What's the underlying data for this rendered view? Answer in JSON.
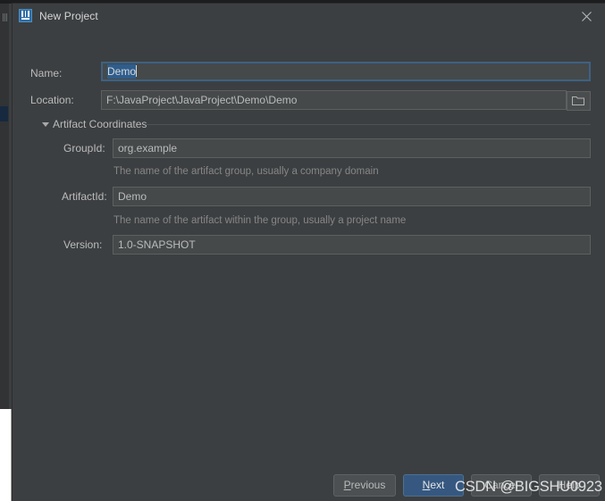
{
  "window": {
    "title": "New Project",
    "app_icon": "intellij-idea-icon",
    "close_icon": "close-icon"
  },
  "form": {
    "name": {
      "label": "Name:",
      "value": "Demo",
      "selected": true
    },
    "location": {
      "label": "Location:",
      "value": "F:\\JavaProject\\JavaProject\\Demo\\Demo",
      "browse_icon": "folder-icon"
    }
  },
  "section": {
    "label": "Artifact Coordinates",
    "expanded": true,
    "toggle_icon": "chevron-down-icon",
    "fields": [
      {
        "label": "GroupId:",
        "value": "org.example",
        "helper": "The name of the artifact group, usually a company domain"
      },
      {
        "label": "ArtifactId:",
        "value": "Demo",
        "helper": "The name of the artifact within the group, usually a project name"
      },
      {
        "label": "Version:",
        "value": "1.0-SNAPSHOT",
        "helper": ""
      }
    ]
  },
  "buttons": {
    "previous": {
      "label": "Previous",
      "mnemonic": "P"
    },
    "next": {
      "label": "Next",
      "mnemonic": "N",
      "default": true
    },
    "cancel": {
      "label": "Cancel"
    },
    "help": {
      "label": "Help"
    }
  },
  "watermark": {
    "text": "CSDN @BIGSHU0923"
  },
  "colors": {
    "dialog_background": "#3c3f41",
    "input_background": "#45494a",
    "accent_blue": "#365880",
    "selection_blue": "#2f5d8c",
    "text_primary": "#bbbbbb",
    "text_muted": "#868686"
  }
}
